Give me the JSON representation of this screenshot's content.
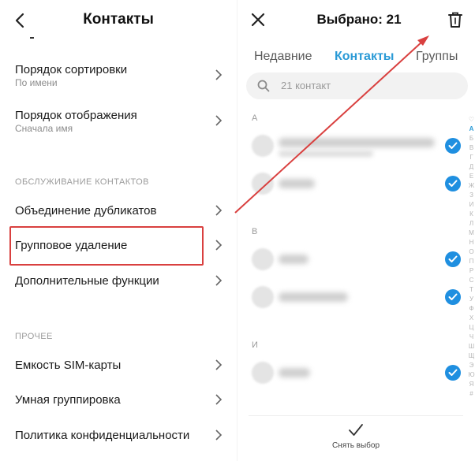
{
  "left": {
    "title": "Контакты",
    "settings": [
      {
        "title": "Порядок сортировки",
        "subtitle": "По имени"
      },
      {
        "title": "Порядок отображения",
        "subtitle": "Сначала имя"
      },
      {
        "title": "Объединение дубликатов"
      },
      {
        "title": "Групповое удаление"
      },
      {
        "title": "Дополнительные функции"
      },
      {
        "title": "Емкость SIM-карты"
      },
      {
        "title": "Умная группировка"
      },
      {
        "title": "Политика конфиденциальности"
      }
    ],
    "sections": {
      "maintenance": "ОБСЛУЖИВАНИЕ КОНТАКТОВ",
      "other": "ПРОЧЕЕ"
    }
  },
  "right": {
    "title": "Выбрано: 21",
    "tabs": [
      "Недавние",
      "Контакты",
      "Группы"
    ],
    "active_tab": "Контакты",
    "search": {
      "placeholder": "21 контакт"
    },
    "groups": [
      "А",
      "В",
      "И"
    ],
    "alphabet": [
      "♡",
      "А",
      "Б",
      "В",
      "Г",
      "Д",
      "Е",
      "Ж",
      "З",
      "И",
      "К",
      "Л",
      "М",
      "Н",
      "О",
      "П",
      "Р",
      "С",
      "Т",
      "У",
      "Ф",
      "Х",
      "Ц",
      "Ч",
      "Ш",
      "Щ",
      "Э",
      "Ю",
      "Я",
      "#"
    ],
    "deselect_label": "Снять выбор"
  },
  "colors": {
    "accent": "#2a9ad6",
    "check": "#1f8fe0",
    "annotation": "#d9403f"
  }
}
